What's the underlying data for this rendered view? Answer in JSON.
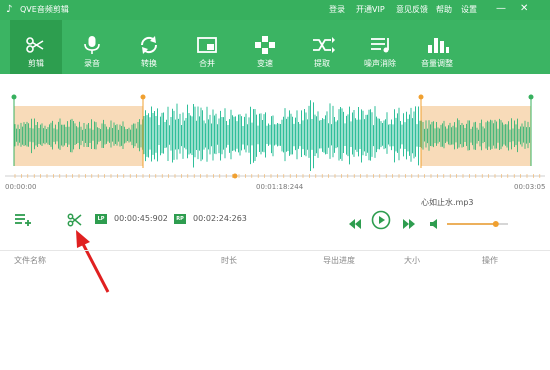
{
  "window": {
    "title": "QVE音频剪辑",
    "menu": [
      "登录",
      "开通VIP",
      "意见反馈",
      "帮助",
      "设置"
    ],
    "accent": "#37b05e"
  },
  "toolbar": {
    "items": [
      {
        "label": "剪辑",
        "icon": "scissors-icon",
        "active": true
      },
      {
        "label": "录音",
        "icon": "microphone-icon",
        "active": false
      },
      {
        "label": "转换",
        "icon": "convert-icon",
        "active": false
      },
      {
        "label": "合并",
        "icon": "merge-icon",
        "active": false
      },
      {
        "label": "变速",
        "icon": "speed-icon",
        "active": false
      },
      {
        "label": "提取",
        "icon": "extract-icon",
        "active": false
      },
      {
        "label": "噪声消除",
        "icon": "noise-reduction-icon",
        "active": false
      },
      {
        "label": "音量调整",
        "icon": "volume-adjust-icon",
        "active": false
      }
    ]
  },
  "timeline": {
    "start": "00:00:00",
    "middle": "00:01:18:244",
    "end": "00:03:05"
  },
  "controls": {
    "start_badge": "LP",
    "start_time": "00:00:45:902",
    "end_badge": "RP",
    "end_time": "00:02:24:263",
    "filename": "心如止水.mp3",
    "volume": 0.8
  },
  "file_table": {
    "columns": [
      "文件名称",
      "时长",
      "导出进度",
      "大小",
      "操作"
    ],
    "rows": []
  }
}
